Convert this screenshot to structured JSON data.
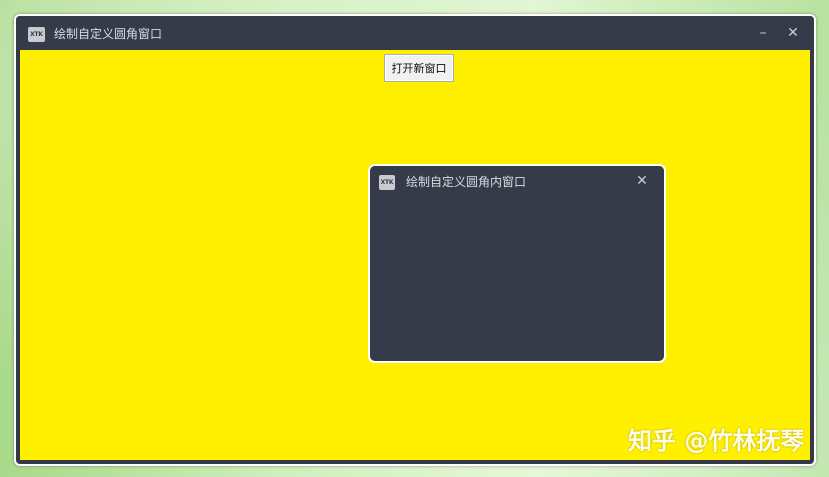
{
  "main_window": {
    "title": "绘制自定义圆角窗口",
    "icon_text": "XTK",
    "minimize_glyph": "–",
    "close_glyph": "✕",
    "open_button_label": "打开新窗口"
  },
  "inner_window": {
    "title": "绘制自定义圆角内窗口",
    "icon_text": "XTK",
    "close_glyph": "✕"
  },
  "watermark": "知乎 @竹林抚琴",
  "colors": {
    "client_bg": "#fff000",
    "titlebar_bg": "#363b49",
    "inner_bg": "#363b49",
    "border": "#ffffff"
  }
}
